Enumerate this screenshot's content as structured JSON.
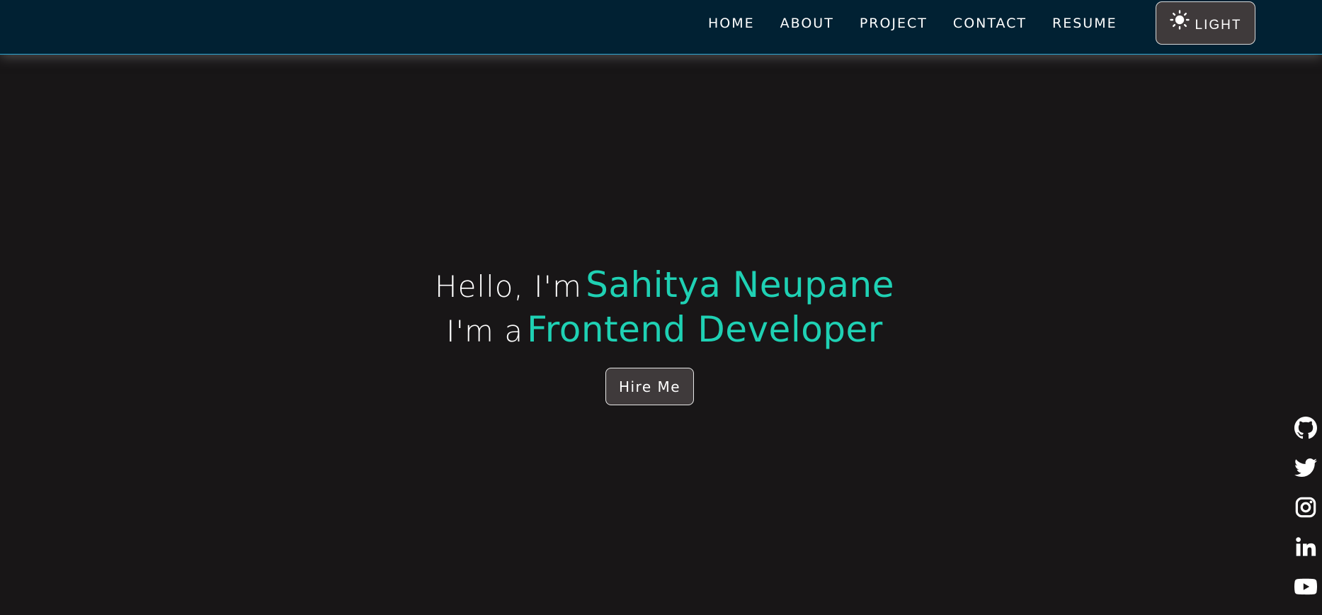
{
  "nav": {
    "items": [
      {
        "label": "HOME"
      },
      {
        "label": "ABOUT"
      },
      {
        "label": "PROJECT"
      },
      {
        "label": "CONTACT"
      },
      {
        "label": "RESUME"
      }
    ],
    "theme_toggle": {
      "label": "LIGHT",
      "icon": "sun-icon"
    }
  },
  "hero": {
    "greeting": "Hello, I'm",
    "name": "Sahitya Neupane",
    "role_prefix": "I'm a",
    "role": "Frontend Developer",
    "cta_label": "Hire Me"
  },
  "social": [
    {
      "icon": "github-icon"
    },
    {
      "icon": "twitter-icon"
    },
    {
      "icon": "instagram-icon"
    },
    {
      "icon": "linkedin-icon"
    },
    {
      "icon": "youtube-icon"
    }
  ],
  "colors": {
    "navbar_bg": "#012133",
    "page_bg": "#181617",
    "accent": "#1fd1b4",
    "button_bg": "#3f3a3b",
    "nav_border": "#2aa6d4"
  }
}
